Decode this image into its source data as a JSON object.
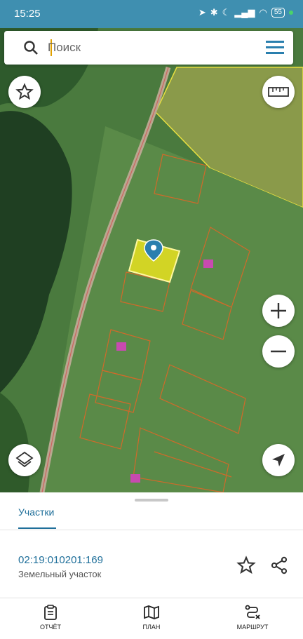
{
  "status": {
    "time": "15:25",
    "battery": "55"
  },
  "search": {
    "placeholder": "Поиск"
  },
  "panel": {
    "tab_label": "Участки",
    "parcel_id": "02:19:010201:169",
    "parcel_type": "Земельный участок"
  },
  "nav": [
    {
      "label": "ОТЧЁТ"
    },
    {
      "label": "ПЛАН"
    },
    {
      "label": "МАРШРУТ"
    }
  ],
  "colors": {
    "accent": "#1f6f9a",
    "statusbar": "#3f8fb0",
    "selected_parcel": "#f0e000"
  }
}
